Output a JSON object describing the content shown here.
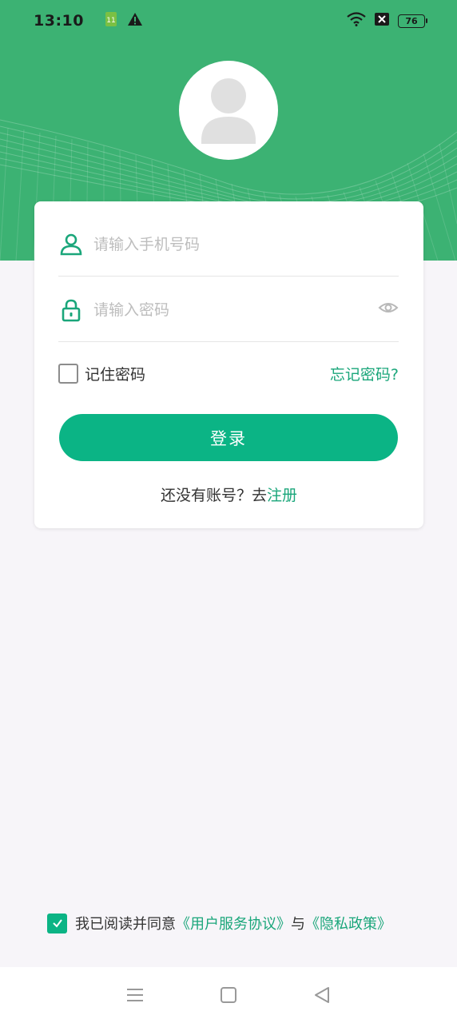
{
  "status_bar": {
    "time": "13:10",
    "battery": "76",
    "icons": [
      "app-notification-icon",
      "warning-icon",
      "wifi-icon",
      "sim-off-icon",
      "battery-icon"
    ]
  },
  "login": {
    "phone_placeholder": "请输入手机号码",
    "password_placeholder": "请输入密码",
    "remember_label": "记住密码",
    "forgot_label": "忘记密码?",
    "login_button": "登录",
    "register_prompt": "还没有账号？去",
    "register_link": "注册"
  },
  "agreement": {
    "checked": true,
    "prefix": "我已阅读并同意",
    "terms_link": "《用户服务协议》",
    "connector": "与",
    "privacy_link": "《隐私政策》"
  },
  "colors": {
    "header": "#3cb273",
    "accent": "#0bb485",
    "link": "#1aa67a",
    "background": "#f7f5f9"
  },
  "nav_bar": {
    "icons": [
      "menu-icon",
      "home-icon",
      "back-icon"
    ]
  }
}
